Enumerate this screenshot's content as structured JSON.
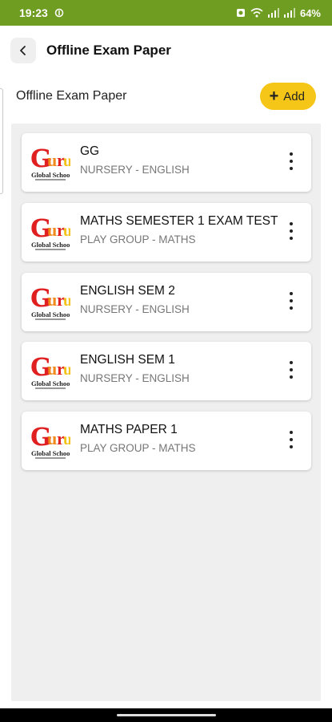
{
  "status_bar": {
    "time": "19:23",
    "battery": "64%"
  },
  "app_bar": {
    "title": "Offline Exam Paper"
  },
  "section": {
    "title": "Offline Exam Paper",
    "add_label": "Add"
  },
  "logo": {
    "word": "Guru",
    "caption": "Global Schoo"
  },
  "papers": [
    {
      "title": "GG",
      "subtitle": "NURSERY - ENGLISH"
    },
    {
      "title": "MATHS SEMESTER 1 EXAM TEST",
      "subtitle": "PLAY GROUP - MATHS"
    },
    {
      "title": "ENGLISH SEM 2",
      "subtitle": "NURSERY - ENGLISH"
    },
    {
      "title": "ENGLISH SEM 1",
      "subtitle": "NURSERY - ENGLISH"
    },
    {
      "title": "MATHS PAPER 1",
      "subtitle": "PLAY GROUP - MATHS"
    }
  ],
  "colors": {
    "status_bar": "#6f9d22",
    "add_button": "#f5c518",
    "list_bg": "#efefef"
  }
}
